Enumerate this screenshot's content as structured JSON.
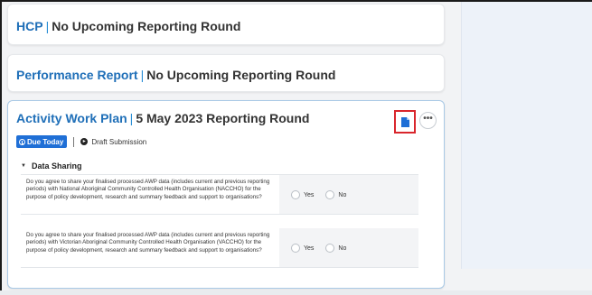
{
  "cards": {
    "hcp": {
      "name": "HCP",
      "status": "No Upcoming Reporting Round"
    },
    "performance": {
      "name": "Performance Report",
      "status": "No Upcoming Reporting Round"
    },
    "awp": {
      "name": "Activity Work Plan",
      "status": "5 May 2023 Reporting Round",
      "due_badge": "Due Today",
      "submission_state": "Draft Submission",
      "more_label": "•••",
      "section": {
        "title": "Data Sharing",
        "questions": [
          {
            "text": "Do you agree to share your finalised processed AWP data (includes current and previous reporting periods) with National Aboriginal Community Controlled Health Organisation (NACCHO) for the purpose of policy development, research and summary feedback and support to organisations?",
            "options": [
              "Yes",
              "No"
            ]
          },
          {
            "text": "Do you agree to share your finalised processed AWP data (includes current and previous reporting periods) with Victorian Aboriginal Community Controlled Health Organisation (VACCHO) for the purpose of policy development, research and summary feedback and support to organisations?",
            "options": [
              "Yes",
              "No"
            ]
          }
        ]
      }
    }
  },
  "icons": {
    "document": "document-icon",
    "more": "more-options-icon",
    "due": "clock-icon",
    "draft": "arrow-right-circle-icon",
    "collapse": "chevron-down-icon"
  },
  "colors": {
    "link": "#1f6fb8",
    "badge": "#1f6fd6",
    "highlight": "#d9262c",
    "right_panel": "#edf2f9"
  }
}
